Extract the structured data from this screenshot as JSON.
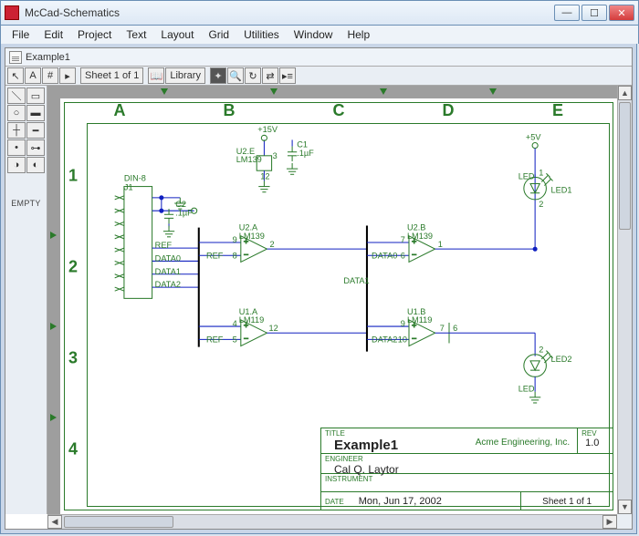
{
  "window": {
    "title": "McCad-Schematics"
  },
  "menu": {
    "file": "File",
    "edit": "Edit",
    "project": "Project",
    "text": "Text",
    "layout": "Layout",
    "grid": "Grid",
    "utilities": "Utilities",
    "window": "Window",
    "help": "Help"
  },
  "doc": {
    "tab": "Example1"
  },
  "toolbar": {
    "sheet": "Sheet 1 of 1",
    "library": "Library"
  },
  "sidepanel": {
    "label": "EMPTY"
  },
  "sheet_labels": {
    "cols": [
      "A",
      "B",
      "C",
      "D",
      "E"
    ],
    "rows": [
      "1",
      "2",
      "3",
      "4"
    ]
  },
  "components": {
    "din8": "DIN-8",
    "j1": "J1",
    "c2": "C2",
    "c2_val": ".1µF",
    "c1": "C1",
    "c1_val": ".1µF",
    "p15v": "+15V",
    "p5v": "+5V",
    "u2e_a": "U2.E",
    "u2e_b": "LM139",
    "u2e_pin3": "3",
    "u2e_pin12": "12",
    "u2a_a": "U2.A",
    "u2a_b": "LM139",
    "u2a_pin9": "9",
    "u2a_pin8": "8",
    "u2a_pin2": "2",
    "u2b_a": "U2.B",
    "u2b_b": "LM139",
    "u2b_pin7": "7",
    "u2b_pin6": "6",
    "u2b_pin1": "1",
    "u1a_a": "U1.A",
    "u1a_b": "LM119",
    "u1a_pin4": "4",
    "u1a_pin5": "5",
    "u1a_pin12": "12",
    "u1b_a": "U1.B",
    "u1b_b": "LM119",
    "u1b_pin9": "9",
    "u1b_pin10": "10",
    "u1b_pin7": "7",
    "u1b_pin6": "6",
    "led_label": "LED",
    "led1": "LED1",
    "led2": "LED2",
    "led1_p1": "1",
    "led1_p2": "2",
    "led2_p2": "2",
    "ref": "REF",
    "data0": "DATA0",
    "data1": "DATA1",
    "data2": "DATA2"
  },
  "titleblock": {
    "title_label": "TITLE",
    "title": "Example1",
    "company": "Acme Engineering, Inc.",
    "rev_label": "REV",
    "rev": "1.0",
    "engineer_label": "ENGINEER",
    "engineer": "Cal Q. Laytor",
    "instrument_label": "INSTRUMENT",
    "date_label": "DATE",
    "date": "Mon, Jun 17, 2002",
    "sheet": "Sheet 1 of 1"
  }
}
